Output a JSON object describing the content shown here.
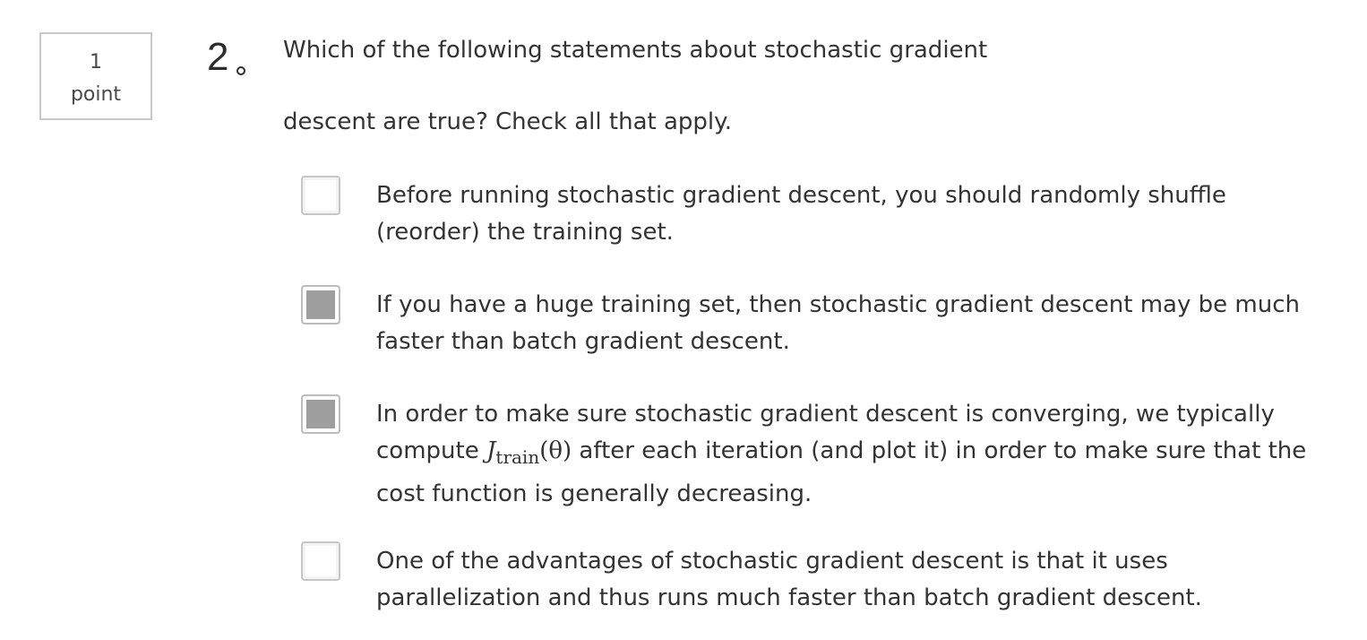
{
  "points": {
    "value": "1",
    "unit": "point"
  },
  "question": {
    "number": "2",
    "prompt_line1": "Which of the following statements about stochastic gradient",
    "prompt_line2": "descent are true? Check all that apply."
  },
  "options": [
    {
      "text": "Before running stochastic gradient descent, you should randomly shuffle (reorder) the training set.",
      "checked": false
    },
    {
      "text": "If you have a huge training set, then stochastic gradient descent may be much faster than batch gradient descent.",
      "checked": true
    },
    {
      "text_before": "In order to make sure stochastic gradient descent is converging, we typically compute ",
      "math_symbol": "J",
      "math_subscript": "train",
      "math_arg": "(θ)",
      "text_after": " after each iteration (and plot it) in order to make sure that the cost function is generally decreasing.",
      "checked": true
    },
    {
      "text": "One of the advantages of stochastic gradient descent is that it uses parallelization and thus runs much faster than batch gradient descent.",
      "checked": false
    }
  ]
}
